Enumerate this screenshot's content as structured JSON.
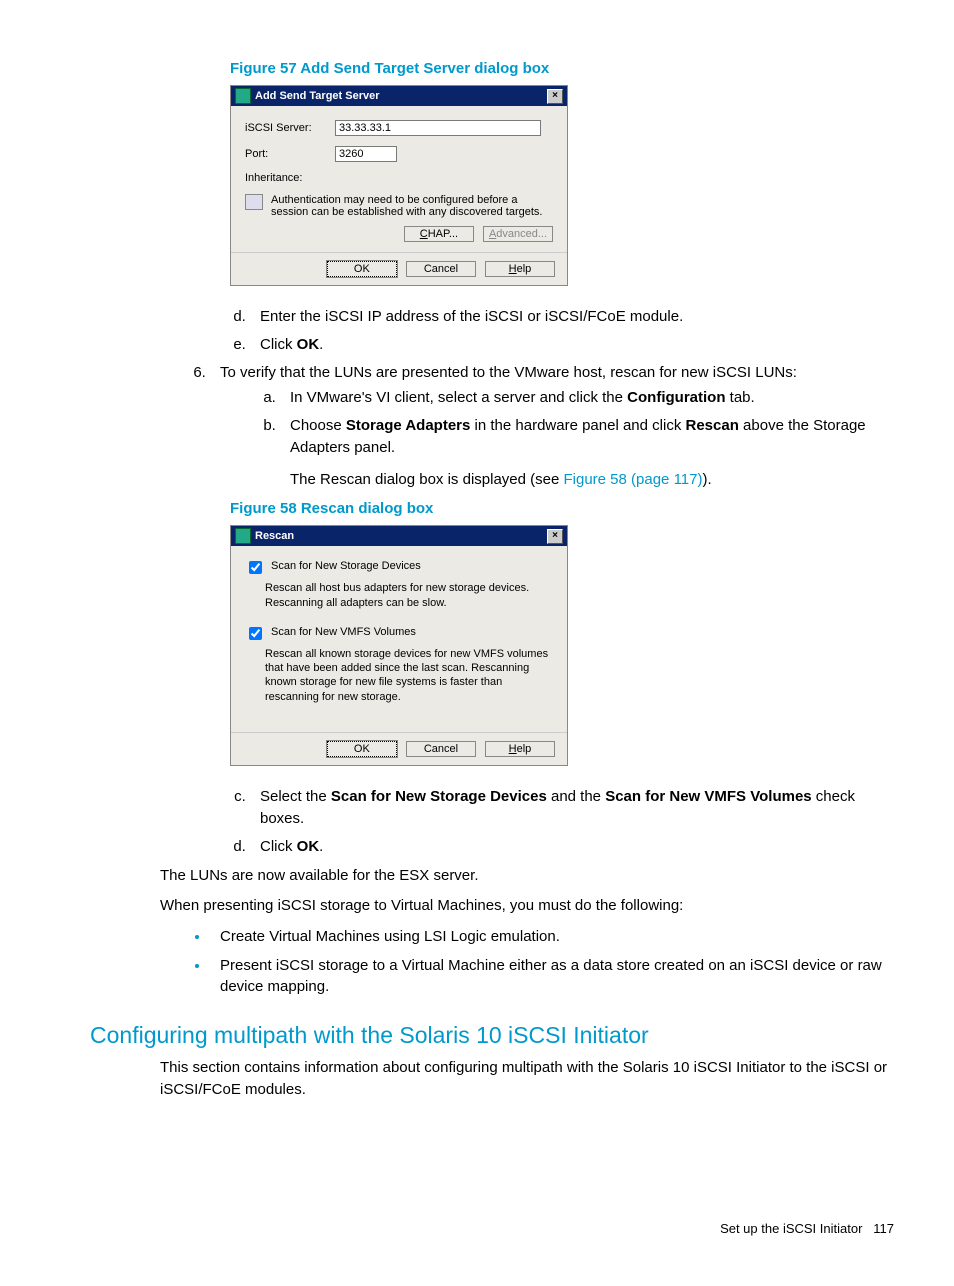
{
  "fig57": {
    "caption": "Figure 57 Add Send Target Server dialog box",
    "title": "Add Send Target Server",
    "label_server": "iSCSI Server:",
    "value_server": "33.33.33.1",
    "label_port": "Port:",
    "value_port": "3260",
    "label_inherit": "Inheritance:",
    "info": "Authentication may need to be configured before a session can be established with any discovered targets.",
    "btn_chap": "CHAP...",
    "btn_adv": "Advanced...",
    "btn_ok": "OK",
    "btn_cancel": "Cancel",
    "btn_help": "Help"
  },
  "steps_de": {
    "d_pre": "Enter the iSCSI IP address of the iSCSI or iSCSI/FCoE module.",
    "e_pre": "Click ",
    "e_b": "OK",
    "e_post": "."
  },
  "step6": {
    "intro": "To verify that the LUNs are presented to the VMware host, rescan for new iSCSI LUNs:",
    "a_pre": "In VMware's VI client, select a server and click the ",
    "a_b": "Configuration",
    "a_post": " tab.",
    "b_pre": "Choose ",
    "b_b1": "Storage Adapters",
    "b_mid": " in the hardware panel and click ",
    "b_b2": "Rescan",
    "b_post": " above the Storage Adapters panel.",
    "b_note_pre": "The Rescan dialog box is displayed (see ",
    "b_link": "Figure 58 (page 117)",
    "b_note_post": ")."
  },
  "fig58": {
    "caption": "Figure 58 Rescan dialog box",
    "title": "Rescan",
    "chk1": "Scan for New Storage Devices",
    "desc1": "Rescan all host bus adapters for new storage devices. Rescanning all adapters can be slow.",
    "chk2": "Scan for New VMFS Volumes",
    "desc2": "Rescan all known storage devices for new VMFS volumes that have been added since the last scan. Rescanning known storage for new file systems is faster than rescanning for new storage.",
    "btn_ok": "OK",
    "btn_cancel": "Cancel",
    "btn_help": "Help"
  },
  "steps_cd": {
    "c_pre": "Select the ",
    "c_b1": "Scan for New Storage Devices",
    "c_mid": " and the ",
    "c_b2": "Scan for New VMFS Volumes",
    "c_post": " check boxes.",
    "d_pre": "Click ",
    "d_b": "OK",
    "d_post": "."
  },
  "para1": "The LUNs are now available for the ESX server.",
  "para2": "When presenting iSCSI storage to Virtual Machines, you must do the following:",
  "bul1": "Create Virtual Machines using LSI Logic emulation.",
  "bul2": "Present iSCSI storage to a Virtual Machine either as a data store created on an iSCSI device or raw device mapping.",
  "h2": "Configuring multipath with the Solaris 10 iSCSI Initiator",
  "sec_p": "This section contains information about configuring multipath with the Solaris 10 iSCSI Initiator to the iSCSI or iSCSI/FCoE modules.",
  "footer_txt": "Set up the iSCSI Initiator",
  "footer_page": "117"
}
